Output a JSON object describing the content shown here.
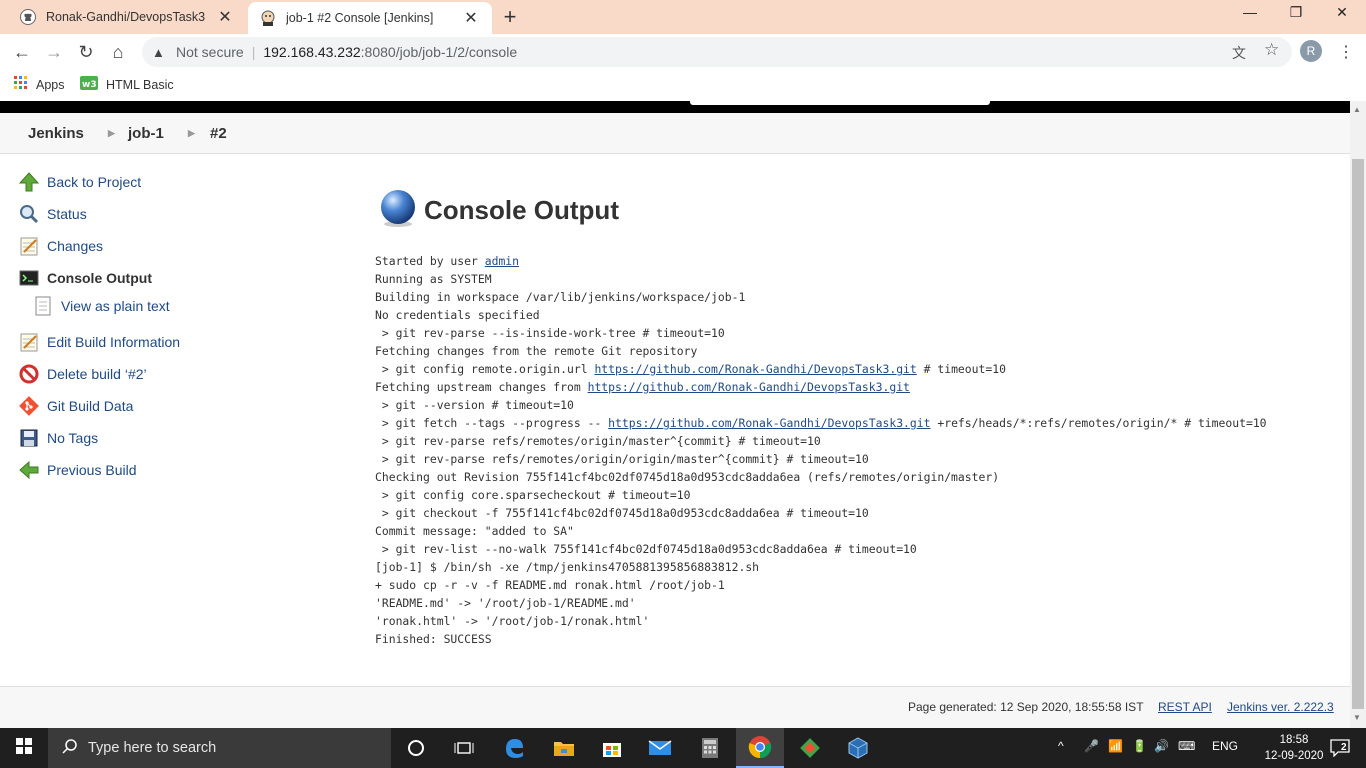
{
  "browser": {
    "tabs": [
      {
        "title": "Ronak-Gandhi/DevopsTask3",
        "active": false
      },
      {
        "title": "job-1 #2 Console [Jenkins]",
        "active": true
      }
    ],
    "not_secure": "Not secure",
    "url_host": "192.168.43.232",
    "url_path": ":8080/job/job-1/2/console",
    "profile_initial": "R",
    "bookmarks": [
      {
        "label": "Apps"
      },
      {
        "label": "HTML Basic"
      }
    ]
  },
  "breadcrumb": [
    "Jenkins",
    "job-1",
    "#2"
  ],
  "sidebar": [
    {
      "label": "Back to Project",
      "icon": "up-arrow-icon"
    },
    {
      "label": "Status",
      "icon": "magnifier-icon"
    },
    {
      "label": "Changes",
      "icon": "notepad-icon"
    },
    {
      "label": "Console Output",
      "icon": "terminal-icon"
    },
    {
      "label": "View as plain text",
      "icon": "document-icon"
    },
    {
      "label": "Edit Build Information",
      "icon": "notepad-icon"
    },
    {
      "label": "Delete build ‘#2’",
      "icon": "no-entry-icon"
    },
    {
      "label": "Git Build Data",
      "icon": "git-icon"
    },
    {
      "label": "No Tags",
      "icon": "floppy-icon"
    },
    {
      "label": "Previous Build",
      "icon": "left-arrow-icon"
    }
  ],
  "main": {
    "title": "Console Output",
    "console": {
      "started_by": "Started by user ",
      "user": "admin",
      "lines_a": "Running as SYSTEM\nBuilding in workspace /var/lib/jenkins/workspace/job-1\nNo credentials specified\n > git rev-parse --is-inside-work-tree # timeout=10\nFetching changes from the remote Git repository\n > git config remote.origin.url ",
      "repo_url": "https://github.com/Ronak-Gandhi/DevopsTask3.git",
      "after_url1": " # timeout=10\nFetching upstream changes from ",
      "after_url2": "\n > git --version # timeout=10\n > git fetch --tags --progress -- ",
      "lines_b": " +refs/heads/*:refs/remotes/origin/* # timeout=10\n > git rev-parse refs/remotes/origin/master^{commit} # timeout=10\n > git rev-parse refs/remotes/origin/origin/master^{commit} # timeout=10\nChecking out Revision 755f141cf4bc02df0745d18a0d953cdc8adda6ea (refs/remotes/origin/master)\n > git config core.sparsecheckout # timeout=10\n > git checkout -f 755f141cf4bc02df0745d18a0d953cdc8adda6ea # timeout=10\nCommit message: \"added to SA\"\n > git rev-list --no-walk 755f141cf4bc02df0745d18a0d953cdc8adda6ea # timeout=10\n[job-1] $ /bin/sh -xe /tmp/jenkins4705881395856883812.sh\n+ sudo cp -r -v -f README.md ronak.html /root/job-1\n'README.md' -> '/root/job-1/README.md'\n'ronak.html' -> '/root/job-1/ronak.html'\nFinished: SUCCESS"
    }
  },
  "footer": {
    "page_generated": "Page generated: 12 Sep 2020, 18:55:58 IST",
    "rest_api": "REST API",
    "version": "Jenkins ver. 2.222.3"
  },
  "taskbar": {
    "search_placeholder": "Type here to search",
    "language": "ENG",
    "time": "18:58",
    "date": "12-09-2020",
    "notifications": "2"
  }
}
